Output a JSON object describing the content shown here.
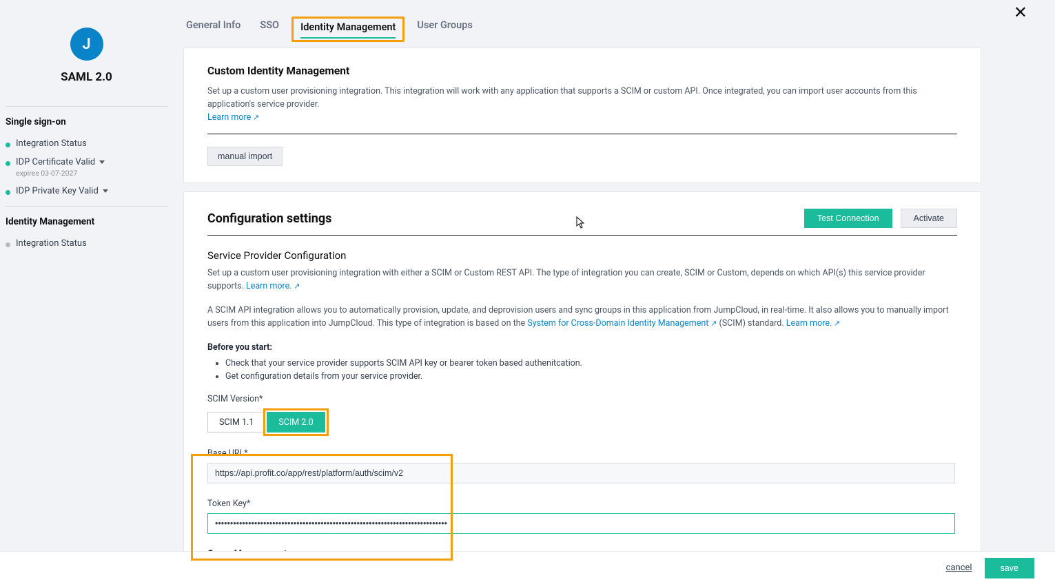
{
  "close_icon": "✕",
  "sidebar": {
    "avatar_initial": "J",
    "title": "SAML 2.0",
    "sso_heading": "Single sign-on",
    "idm_heading": "Identity Management",
    "sso_items": [
      {
        "label": "Integration Status",
        "dot": "green",
        "has_caret": false,
        "sub": ""
      },
      {
        "label": "IDP Certificate Valid",
        "dot": "green",
        "has_caret": true,
        "sub": "expires 03-07-2027"
      },
      {
        "label": "IDP Private Key Valid",
        "dot": "green",
        "has_caret": true,
        "sub": ""
      }
    ],
    "idm_items": [
      {
        "label": "Integration Status",
        "dot": "gray",
        "has_caret": false,
        "sub": ""
      }
    ]
  },
  "tabs": {
    "general": "General Info",
    "sso": "SSO",
    "idm": "Identity Management",
    "user_groups": "User Groups"
  },
  "custom_idm": {
    "title": "Custom Identity Management",
    "desc": "Set up a custom user provisioning integration. This integration will work with any application that supports a SCIM or custom API. Once integrated, you can import user accounts from this application's service provider.",
    "learn_more": "Learn more",
    "manual_import": "manual import"
  },
  "config": {
    "title": "Configuration settings",
    "test_btn": "Test Connection",
    "activate_btn": "Activate",
    "sp_title": "Service Provider Configuration",
    "sp_desc": "Set up a custom user provisioning integration with either a SCIM or Custom REST API. The type of integration you can create, SCIM or Custom, depends on which API(s) this service provider supports.",
    "sp_learn_more": "Learn more.",
    "scim_para_a": "A SCIM API integration allows you to automatically provision, update, and deprovision users and sync groups in this application from JumpCloud, in real-time. It also allows you to manually import users from this application into JumpCloud. This type of integration is based on the ",
    "scim_link": "System for Cross-Domain Identity Management",
    "scim_para_b": " (SCIM) standard. ",
    "scim_learn_more": "Learn more.",
    "before_label": "Before you start:",
    "check1": "Check that your service provider supports SCIM API key or bearer token based authenitcation.",
    "check2": "Get configuration details from your service provider.",
    "scim_version_label": "SCIM Version*",
    "scim11": "SCIM 1.1",
    "scim20": "SCIM 2.0",
    "base_url_label": "Base URL*",
    "base_url_value": "https://api.profit.co/app/rest/platform/auth/scim/v2",
    "token_label": "Token Key*",
    "token_value": "•••••••••••••••••••••••••••••••••••••••••••••••••••••••••••••••••••••••••••••",
    "group_mgmt": "Group Management"
  },
  "footer": {
    "cancel": "cancel",
    "save": "save"
  }
}
